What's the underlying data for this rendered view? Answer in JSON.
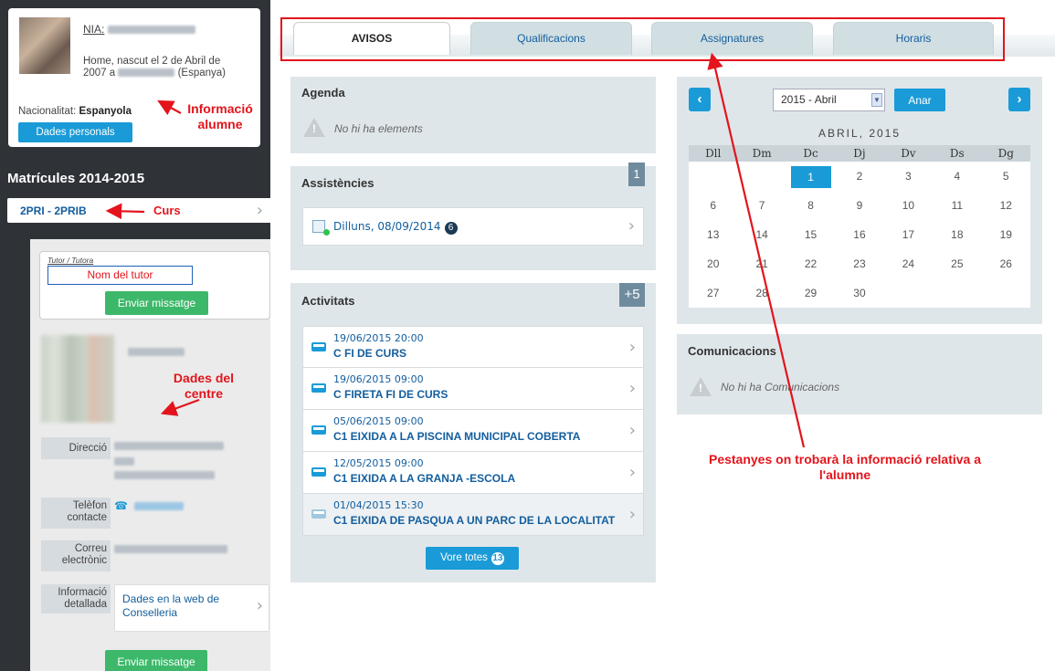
{
  "student": {
    "nia_label": "NIA:",
    "born_text_1": "Home, nascut el 2 de Abril de",
    "born_text_2": "2007 a",
    "born_text_3": "(Espanya)",
    "nationality_label": "Nacionalitat:",
    "nationality_value": "Espanyola",
    "personal_data_button": "Dades personals"
  },
  "annotations": {
    "student_info": "Informació alumne",
    "course": "Curs",
    "centre": "Dades del centre",
    "tabs": "Pestanyes on trobarà la informació relativa a l'alumne"
  },
  "sidebar": {
    "enrolments_title": "Matrícules 2014-2015",
    "course_code": "2PRI - 2PRIB"
  },
  "tutor": {
    "label": "Tutor / Tutora",
    "name_placeholder": "Nom del tutor",
    "send_message": "Enviar missatge"
  },
  "centre": {
    "address_label": "Direcció",
    "phone_label": "Telèfon contacte",
    "email_label": "Correu electrònic",
    "details_label": "Informació detallada",
    "web_link": "Dades en la web de Conselleria",
    "send_message": "Enviar missatge"
  },
  "tabs": [
    {
      "label": "AVISOS"
    },
    {
      "label": "Qualificacions"
    },
    {
      "label": "Assignatures"
    },
    {
      "label": "Horaris"
    }
  ],
  "agenda": {
    "title": "Agenda",
    "empty": "No hi ha elements"
  },
  "assistencies": {
    "title": "Assistències",
    "count": "1",
    "item_date": "Dilluns, 08/09/2014",
    "item_count": "6"
  },
  "activitats": {
    "title": "Activitats",
    "count": "+5",
    "items": [
      {
        "time": "19/06/2015 20:00",
        "name": "C FI DE CURS"
      },
      {
        "time": "19/06/2015 09:00",
        "name": "C FIRETA FI DE CURS"
      },
      {
        "time": "05/06/2015 09:00",
        "name": "C1 EIXIDA A LA PISCINA MUNICIPAL COBERTA"
      },
      {
        "time": "12/05/2015 09:00",
        "name": "C1 EIXIDA A LA GRANJA -ESCOLA"
      },
      {
        "time": "01/04/2015 15:30",
        "name": "C1 EIXIDA DE PASQUA A UN PARC DE LA LOCALITAT"
      }
    ],
    "see_all": "Vore totes",
    "see_all_count": "13"
  },
  "calendar": {
    "select_value": "2015 - Abril",
    "go_button": "Anar",
    "month_title": "ABRIL, 2015",
    "weekdays": [
      "Dll",
      "Dm",
      "Dc",
      "Dj",
      "Dv",
      "Ds",
      "Dg"
    ],
    "weeks": [
      [
        "",
        "",
        "1",
        "2",
        "3",
        "4",
        "5"
      ],
      [
        "6",
        "7",
        "8",
        "9",
        "10",
        "11",
        "12"
      ],
      [
        "13",
        "14",
        "15",
        "16",
        "17",
        "18",
        "19"
      ],
      [
        "20",
        "21",
        "22",
        "23",
        "24",
        "25",
        "26"
      ],
      [
        "27",
        "28",
        "29",
        "30",
        "",
        "",
        ""
      ]
    ],
    "today": "1"
  },
  "comunicacions": {
    "title": "Comunicacions",
    "empty": "No hi ha Comunicacions"
  },
  "colors": {
    "accent": "#1a9bd7",
    "sidebar_bg": "#2f3338",
    "panel_bg": "#dfe6ea",
    "annotation_red": "#e3141c",
    "green_button": "#3db86a"
  }
}
